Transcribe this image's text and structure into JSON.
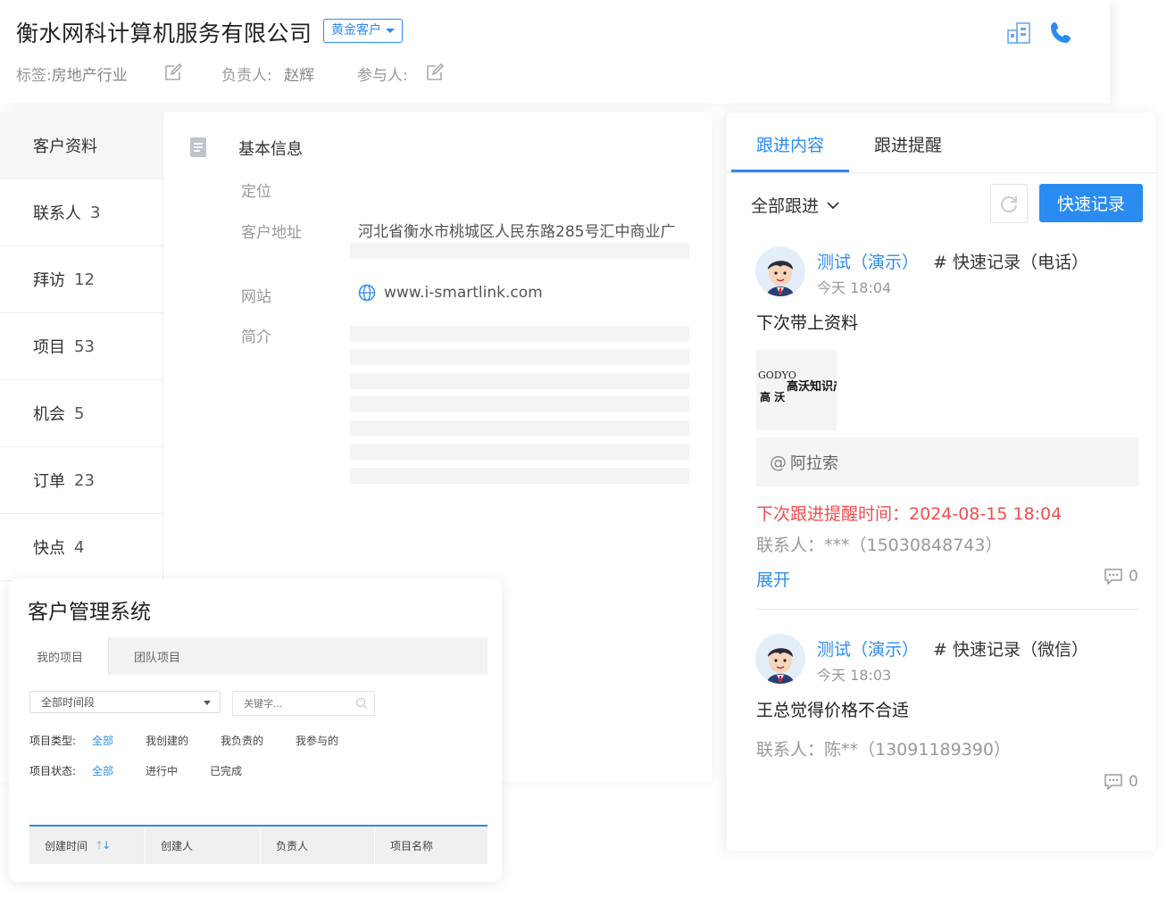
{
  "header": {
    "company_name": "衡水网科计算机服务有限公司",
    "level_badge": "黄金客户",
    "tag_label": "标签:",
    "tag_value": "房地产行业",
    "owner_label": "负责人:",
    "owner_value": "赵辉",
    "participants_label": "参与人:"
  },
  "sidebar": {
    "items": [
      {
        "label": "客户资料",
        "count": ""
      },
      {
        "label": "联系人",
        "count": "3"
      },
      {
        "label": "拜访",
        "count": "12"
      },
      {
        "label": "项目",
        "count": "53"
      },
      {
        "label": "机会",
        "count": "5"
      },
      {
        "label": "订单",
        "count": "23"
      },
      {
        "label": "快点",
        "count": "4"
      }
    ]
  },
  "basic_info": {
    "section_title": "基本信息",
    "fields": {
      "position_label": "定位",
      "address_label": "客户地址",
      "address_value": "河北省衡水市桃城区人民东路285号汇中商业广",
      "website_label": "网站",
      "website_value": "www.i-smartlink.com",
      "intro_label": "简介"
    }
  },
  "follow": {
    "tabs": [
      "跟进内容",
      "跟进提醒"
    ],
    "filter_label": "全部跟进",
    "quick_record_button": "快速记录",
    "records": [
      {
        "author": "测试（演示）",
        "type": "# 快速记录（电话）",
        "time": "今天 18:04",
        "content": "下次带上资料",
        "image_text_top": "GODYO",
        "image_text_main": "高沃知识产权",
        "image_text_sub": "高 沃",
        "mention": "阿拉索",
        "remind": "下次跟进提醒时间：2024-08-15 18:04",
        "contact": "联系人：***（15030848743）",
        "expand": "展开",
        "comments": "0"
      },
      {
        "author": "测试（演示）",
        "type": "# 快速记录（微信）",
        "time": "今天 18:03",
        "content": "王总觉得价格不合适",
        "contact": "联系人：陈**（13091189390）",
        "comments": "0"
      }
    ]
  },
  "project_mgmt": {
    "title": "客户管理系统",
    "tabs": [
      "我的项目",
      "团队项目"
    ],
    "time_select": "全部时间段",
    "search_placeholder": "关键字...",
    "type_label": "项目类型:",
    "type_options": [
      "全部",
      "我创建的",
      "我负责的",
      "我参与的"
    ],
    "status_label": "项目状态:",
    "status_options": [
      "全部",
      "进行中",
      "已完成"
    ],
    "table_headers": [
      "创建时间",
      "创建人",
      "负责人",
      "项目名称"
    ]
  },
  "colors": {
    "accent": "#2a8cf0",
    "alert": "#ee4d4d"
  }
}
